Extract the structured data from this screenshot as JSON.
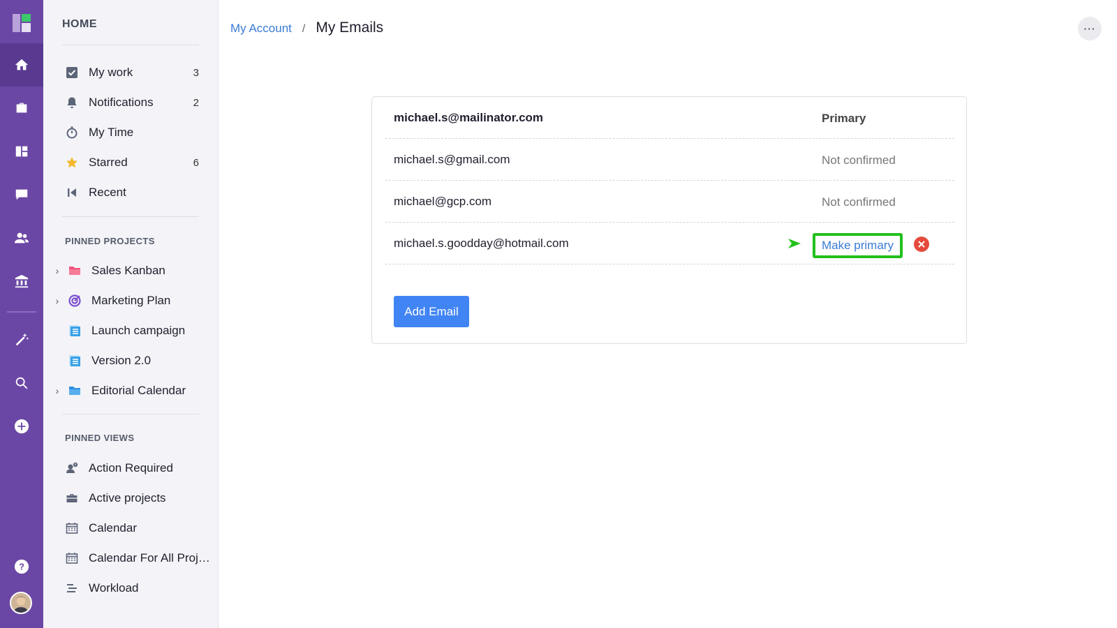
{
  "sidebar": {
    "home_label": "HOME",
    "main_items": [
      {
        "label": "My work",
        "count": "3",
        "icon": "checkbox-icon"
      },
      {
        "label": "Notifications",
        "count": "2",
        "icon": "bell-icon"
      },
      {
        "label": "My Time",
        "count": "",
        "icon": "stopwatch-icon"
      },
      {
        "label": "Starred",
        "count": "6",
        "icon": "star-icon"
      },
      {
        "label": "Recent",
        "count": "",
        "icon": "rewind-icon"
      }
    ],
    "pinned_projects_label": "PINNED PROJECTS",
    "projects": [
      {
        "label": "Sales Kanban",
        "expandable": true,
        "icon": "folder-icon"
      },
      {
        "label": "Marketing Plan",
        "expandable": true,
        "icon": "target-icon"
      },
      {
        "label": "Launch campaign",
        "expandable": false,
        "icon": "list-icon"
      },
      {
        "label": "Version 2.0",
        "expandable": false,
        "icon": "list-icon"
      },
      {
        "label": "Editorial Calendar",
        "expandable": true,
        "icon": "folder-icon"
      }
    ],
    "pinned_views_label": "PINNED VIEWS",
    "views": [
      {
        "label": "Action Required",
        "icon": "user-alert-icon"
      },
      {
        "label": "Active projects",
        "icon": "briefcase-icon"
      },
      {
        "label": "Calendar",
        "icon": "calendar-icon"
      },
      {
        "label": "Calendar For All Proje...",
        "icon": "calendar-icon"
      },
      {
        "label": "Workload",
        "icon": "workload-icon"
      }
    ]
  },
  "header": {
    "breadcrumb_parent": "My Account",
    "breadcrumb_separator": "/",
    "title": "My Emails",
    "more_label": "···"
  },
  "emails": [
    {
      "address": "michael.s@mailinator.com",
      "status": "Primary"
    },
    {
      "address": "michael.s@gmail.com",
      "status": "Not confirmed"
    },
    {
      "address": "michael@gcp.com",
      "status": "Not confirmed"
    },
    {
      "address": "michael.s.goodday@hotmail.com",
      "action": "Make primary"
    }
  ],
  "add_email_label": "Add Email",
  "colors": {
    "rail": "#6b47a5",
    "accent": "#4184f3",
    "link": "#3a7bd5",
    "highlight": "#22c01c",
    "danger": "#e54b3c"
  }
}
